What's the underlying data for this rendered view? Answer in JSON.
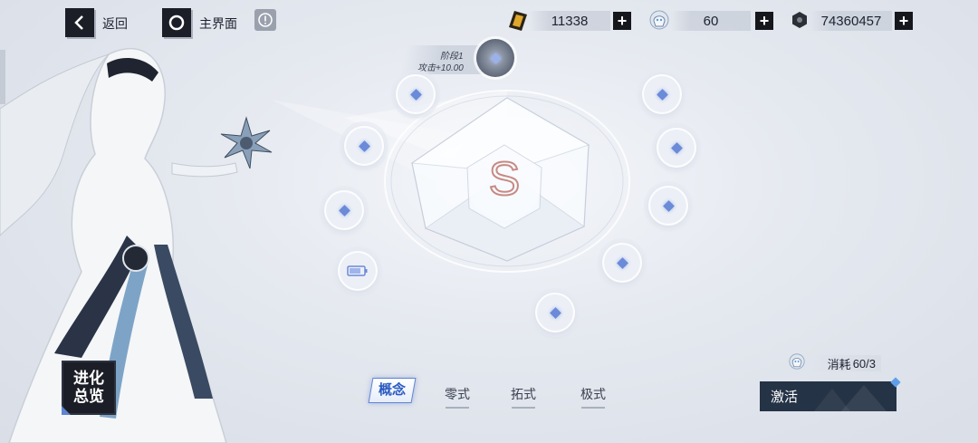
{
  "topbar": {
    "back_label": "返回",
    "home_label": "主界面",
    "info_icon": "exclamation-icon"
  },
  "resources": [
    {
      "icon": "gold-ticket-icon",
      "value": "11338"
    },
    {
      "icon": "character-portrait-icon",
      "value": "60"
    },
    {
      "icon": "hex-nut-icon",
      "value": "74360457"
    }
  ],
  "stage_tooltip": {
    "line1": "阶段1",
    "line2": "攻击+10.00"
  },
  "core": {
    "letter": "S"
  },
  "evolution_overview": {
    "line1": "进化",
    "line2": "总览"
  },
  "tabs": [
    {
      "label": "概念",
      "active": true
    },
    {
      "label": "零式",
      "active": false
    },
    {
      "label": "拓式",
      "active": false
    },
    {
      "label": "极式",
      "active": false
    }
  ],
  "cost": {
    "label": "消耗",
    "value": "60/3"
  },
  "activate_label": "激活",
  "colors": {
    "accent": "#5f84d2",
    "node_diamond": "#6b8ad8",
    "button_dark": "#253346"
  }
}
